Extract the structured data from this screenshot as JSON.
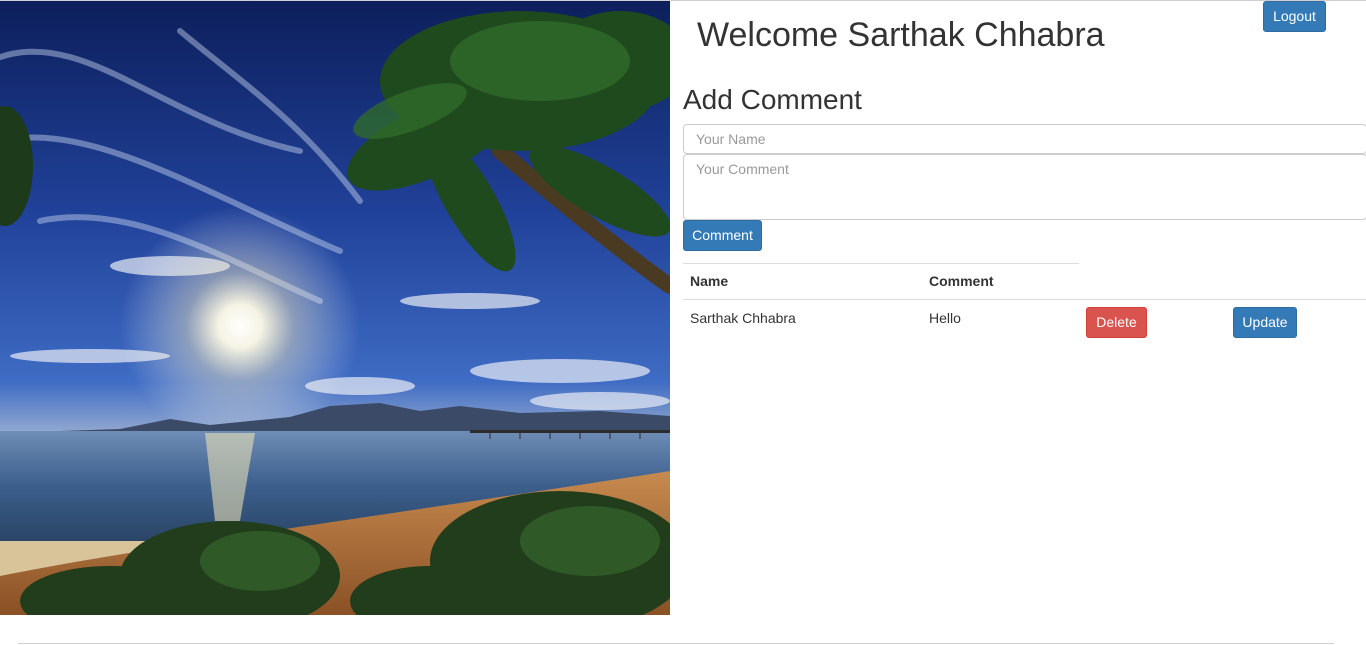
{
  "header": {
    "welcome_text": "Welcome Sarthak Chhabra",
    "logout_label": "Logout"
  },
  "form": {
    "title": "Add Comment",
    "name_placeholder": "Your Name",
    "comment_placeholder": "Your Comment",
    "submit_label": "Comment"
  },
  "table": {
    "headers": [
      "Name",
      "Comment"
    ],
    "rows": [
      {
        "name": "Sarthak Chhabra",
        "comment": "Hello",
        "delete_label": "Delete",
        "update_label": "Update"
      }
    ]
  },
  "colors": {
    "primary": "#337ab7",
    "danger": "#d9534f",
    "text": "#333333"
  }
}
